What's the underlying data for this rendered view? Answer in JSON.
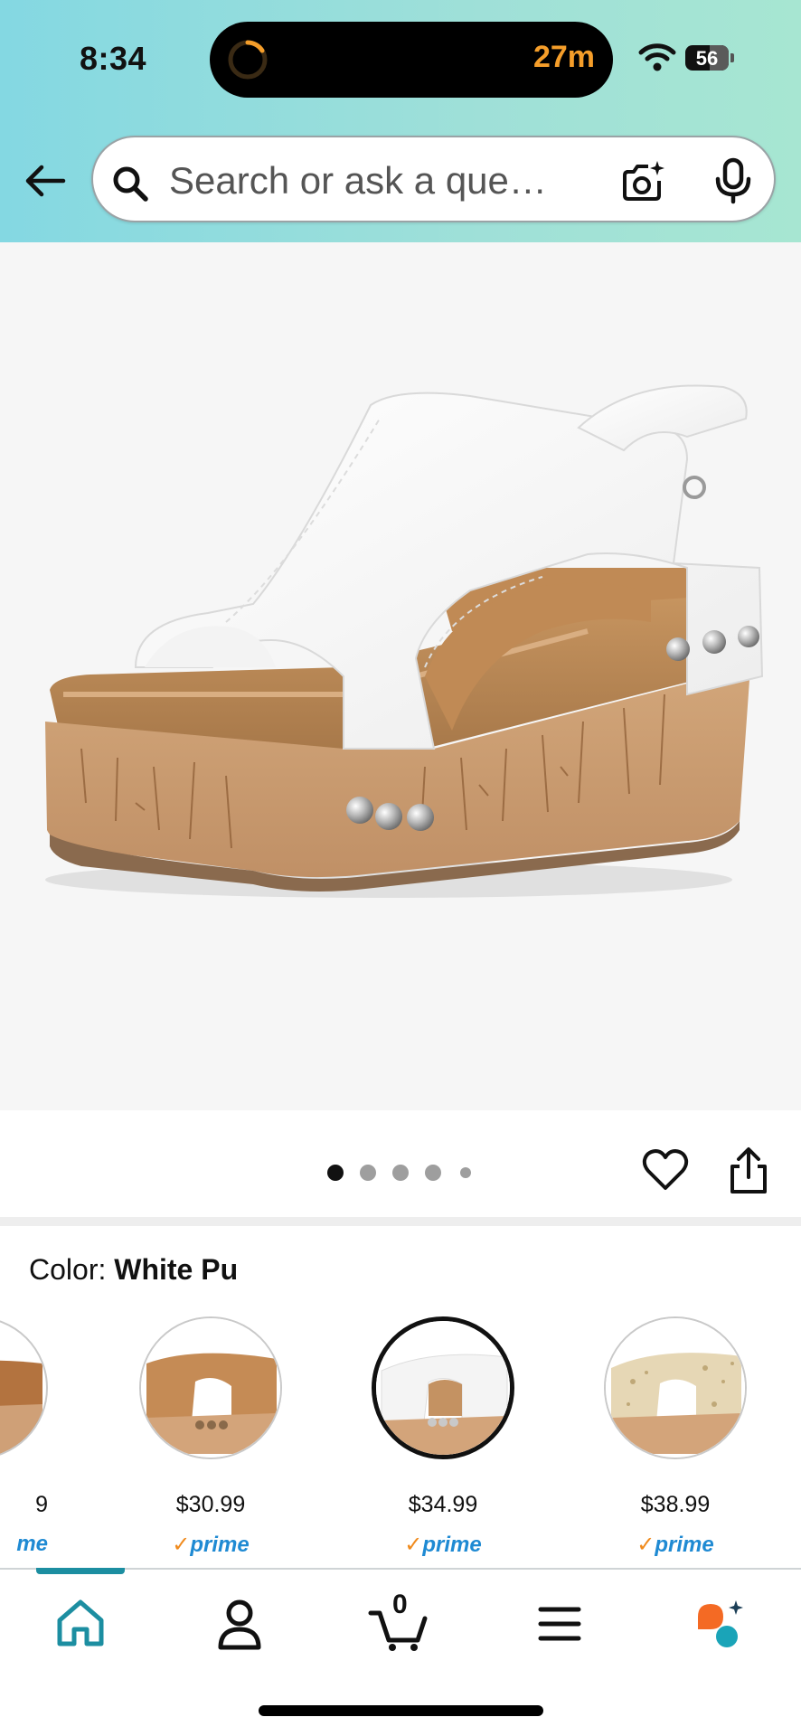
{
  "status_bar": {
    "time": "8:34",
    "activity_timer": "27m",
    "battery_level": "56"
  },
  "search": {
    "placeholder": "Search or ask a que…"
  },
  "product": {
    "image_alt": "White wedge sandal with cork heel and silver studs",
    "carousel": {
      "total": 5,
      "current": 1
    }
  },
  "color_section": {
    "label": "Color:",
    "selected_name": "White Pu"
  },
  "swatches": [
    {
      "price": "9",
      "prime": "me",
      "tone": "brown"
    },
    {
      "price": "$30.99",
      "prime": "prime",
      "tone": "tan"
    },
    {
      "price": "$34.99",
      "prime": "prime",
      "tone": "white",
      "selected": true
    },
    {
      "price": "$38.99",
      "prime": "prime",
      "tone": "gold-glitter"
    }
  ],
  "bottom_nav": {
    "items": [
      "home-icon",
      "account-icon",
      "cart-icon",
      "menu-icon",
      "rufus-icon"
    ],
    "active": "home-icon",
    "cart_count": "0"
  },
  "colors": {
    "header_gradient_start": "#84d8e2",
    "header_gradient_end": "#a7e6d2",
    "nav_active": "#1c8ea1",
    "prime_blue": "#1f8ad3",
    "prime_check": "#f08a1c"
  }
}
